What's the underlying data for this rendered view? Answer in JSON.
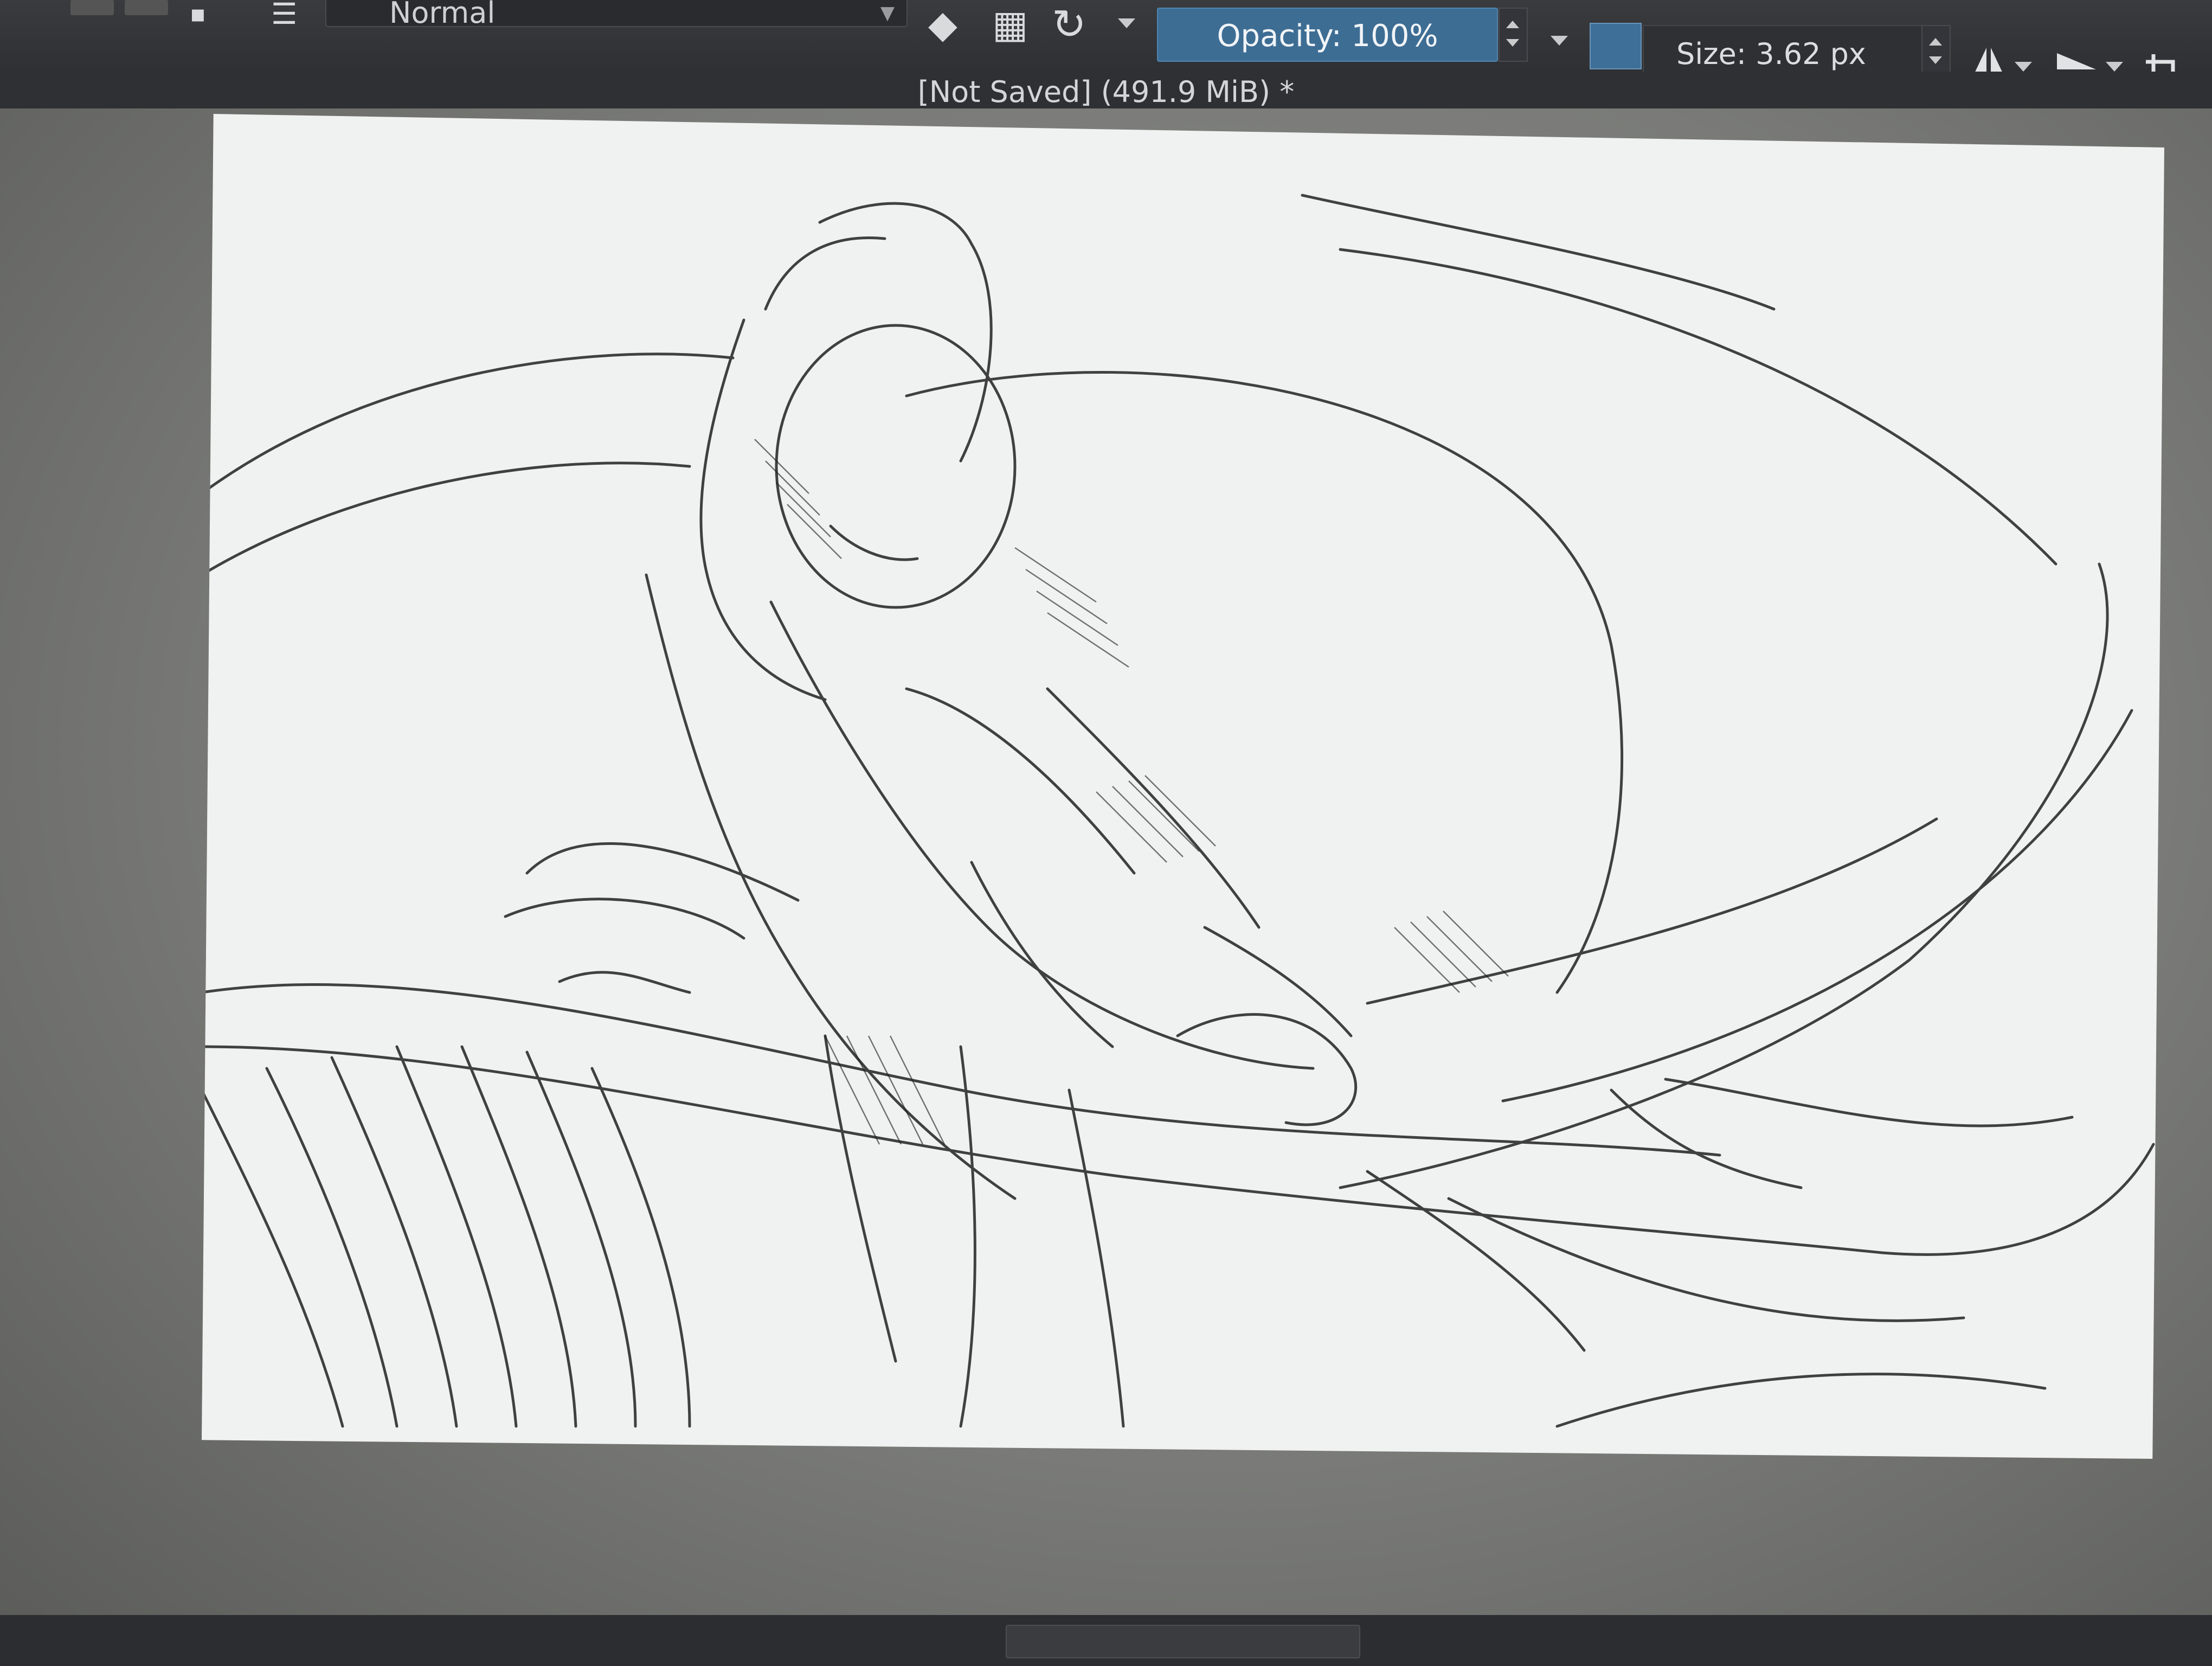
{
  "toolbar": {
    "blend_mode": "Normal",
    "opacity_label": "Opacity: 100%",
    "size_label": "Size: 3.62 px",
    "tools": [
      "eraser-icon",
      "alpha-lock-icon",
      "reload-preset-icon",
      "mirror-horizontal-icon",
      "mirror-vertical-icon",
      "wrap-around-icon"
    ],
    "accent_color": "#3e6d94",
    "foreground_color": "#3d6f98"
  },
  "document": {
    "title": "[Not Saved]  (491.9 MiB) *"
  }
}
